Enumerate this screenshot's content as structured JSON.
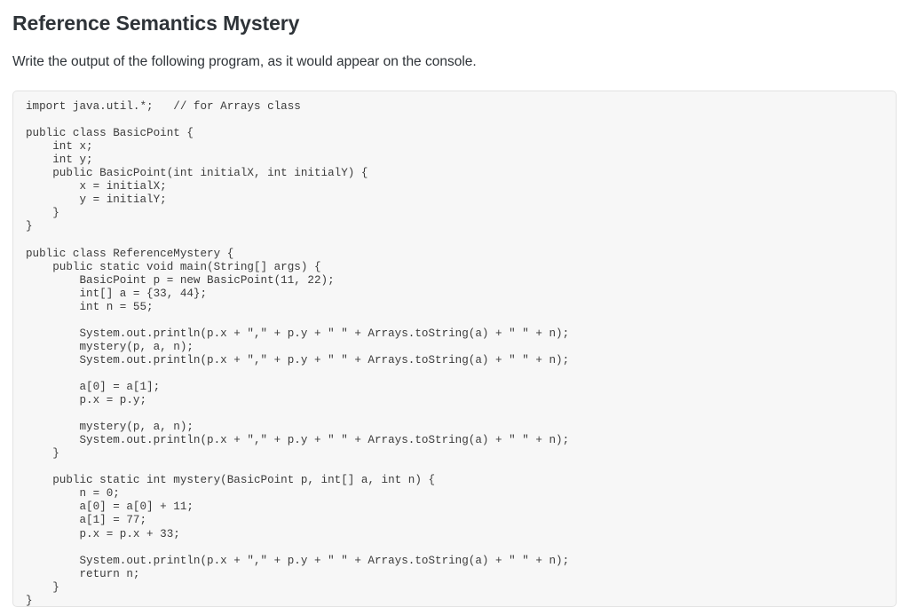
{
  "page": {
    "title": "Reference Semantics Mystery",
    "prompt": "Write the output of the following program, as it would appear on the console.",
    "language": "java"
  },
  "code": {
    "lines": [
      "import java.util.*;   // for Arrays class",
      "",
      "public class BasicPoint {",
      "    int x;",
      "    int y;",
      "    public BasicPoint(int initialX, int initialY) {",
      "        x = initialX;",
      "        y = initialY;",
      "    }",
      "}",
      "",
      "public class ReferenceMystery {",
      "    public static void main(String[] args) {",
      "        BasicPoint p = new BasicPoint(11, 22);",
      "        int[] a = {33, 44};",
      "        int n = 55;",
      "",
      "        System.out.println(p.x + \",\" + p.y + \" \" + Arrays.toString(a) + \" \" + n);",
      "        mystery(p, a, n);",
      "        System.out.println(p.x + \",\" + p.y + \" \" + Arrays.toString(a) + \" \" + n);",
      "",
      "        a[0] = a[1];",
      "        p.x = p.y;",
      "",
      "        mystery(p, a, n);",
      "        System.out.println(p.x + \",\" + p.y + \" \" + Arrays.toString(a) + \" \" + n);",
      "    }",
      "",
      "    public static int mystery(BasicPoint p, int[] a, int n) {",
      "        n = 0;",
      "        a[0] = a[0] + 11;",
      "        a[1] = 77;",
      "        p.x = p.x + 33;",
      "",
      "        System.out.println(p.x + \",\" + p.y + \" \" + Arrays.toString(a) + \" \" + n);",
      "        return n;",
      "    }",
      "}"
    ]
  },
  "colors": {
    "page_background": "#ffffff",
    "title_text": "#2e3338",
    "body_text": "#2e3338",
    "code_background": "#f7f7f7",
    "code_border": "#e3e3e3",
    "code_text": "#3b3b3b"
  }
}
